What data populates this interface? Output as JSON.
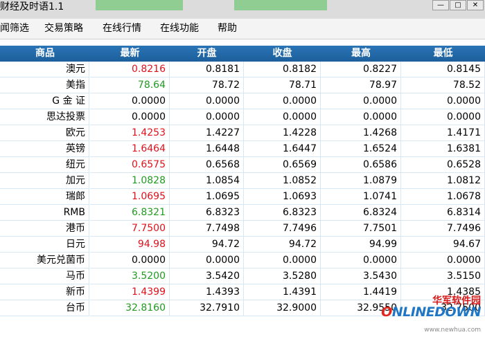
{
  "window": {
    "title": "财经及时语1.1",
    "min_label": "—",
    "max_label": "□",
    "close_label": "✕"
  },
  "menu": [
    {
      "label": "闻筛选"
    },
    {
      "label": "交易策略"
    },
    {
      "label": "在线行情"
    },
    {
      "label": "在线功能"
    },
    {
      "label": "帮助"
    }
  ],
  "table": {
    "headers": [
      "商品",
      "最新",
      "开盘",
      "收盘",
      "最高",
      "最低"
    ],
    "rows": [
      {
        "name": "澳元",
        "latest": "0.8216",
        "latest_color": "red",
        "open": "0.8181",
        "close": "0.8182",
        "high": "0.8227",
        "low": "0.8145"
      },
      {
        "name": "美指",
        "latest": "78.64",
        "latest_color": "green",
        "open": "78.72",
        "close": "78.71",
        "high": "78.97",
        "low": "78.52"
      },
      {
        "name": "G 金 证",
        "latest": "0.0000",
        "latest_color": "black",
        "open": "0.0000",
        "close": "0.0000",
        "high": "0.0000",
        "low": "0.0000"
      },
      {
        "name": "思达投票",
        "latest": "0.0000",
        "latest_color": "black",
        "open": "0.0000",
        "close": "0.0000",
        "high": "0.0000",
        "low": "0.0000"
      },
      {
        "name": "欧元",
        "latest": "1.4253",
        "latest_color": "red",
        "open": "1.4227",
        "close": "1.4228",
        "high": "1.4268",
        "low": "1.4171"
      },
      {
        "name": "英镑",
        "latest": "1.6464",
        "latest_color": "red",
        "open": "1.6448",
        "close": "1.6447",
        "high": "1.6524",
        "low": "1.6381"
      },
      {
        "name": "纽元",
        "latest": "0.6575",
        "latest_color": "red",
        "open": "0.6568",
        "close": "0.6569",
        "high": "0.6586",
        "low": "0.6528"
      },
      {
        "name": "加元",
        "latest": "1.0828",
        "latest_color": "green",
        "open": "1.0854",
        "close": "1.0852",
        "high": "1.0879",
        "low": "1.0812"
      },
      {
        "name": "瑞郎",
        "latest": "1.0695",
        "latest_color": "red",
        "open": "1.0695",
        "close": "1.0693",
        "high": "1.0741",
        "low": "1.0678"
      },
      {
        "name": "RMB",
        "latest": "6.8321",
        "latest_color": "green",
        "open": "6.8323",
        "close": "6.8323",
        "high": "6.8324",
        "low": "6.8314"
      },
      {
        "name": "港币",
        "latest": "7.7500",
        "latest_color": "red",
        "open": "7.7498",
        "close": "7.7496",
        "high": "7.7501",
        "low": "7.7496"
      },
      {
        "name": "日元",
        "latest": "94.98",
        "latest_color": "red",
        "open": "94.72",
        "close": "94.72",
        "high": "94.99",
        "low": "94.67"
      },
      {
        "name": "美元兑菌币",
        "latest": "0.0000",
        "latest_color": "black",
        "open": "0.0000",
        "close": "0.0000",
        "high": "0.0000",
        "low": "0.0000"
      },
      {
        "name": "马币",
        "latest": "3.5200",
        "latest_color": "green",
        "open": "3.5420",
        "close": "3.5280",
        "high": "3.5430",
        "low": "3.5150"
      },
      {
        "name": "新币",
        "latest": "1.4399",
        "latest_color": "red",
        "open": "1.4393",
        "close": "1.4391",
        "high": "1.4419",
        "low": "1.4385"
      },
      {
        "name": "台币",
        "latest": "32.8160",
        "latest_color": "green",
        "open": "32.7910",
        "close": "32.9000",
        "high": "32.9550",
        "low": "32.7500"
      }
    ]
  },
  "watermark": {
    "cn": "华军软件园",
    "logo_o": "O",
    "logo_rest": "NLINEDOWN",
    "url": "www.newhua.com"
  },
  "colors": {
    "header_bg": "#1f64a3",
    "grid": "#d7e7f3",
    "up": "#e0101b",
    "down": "#1f9b1f"
  }
}
